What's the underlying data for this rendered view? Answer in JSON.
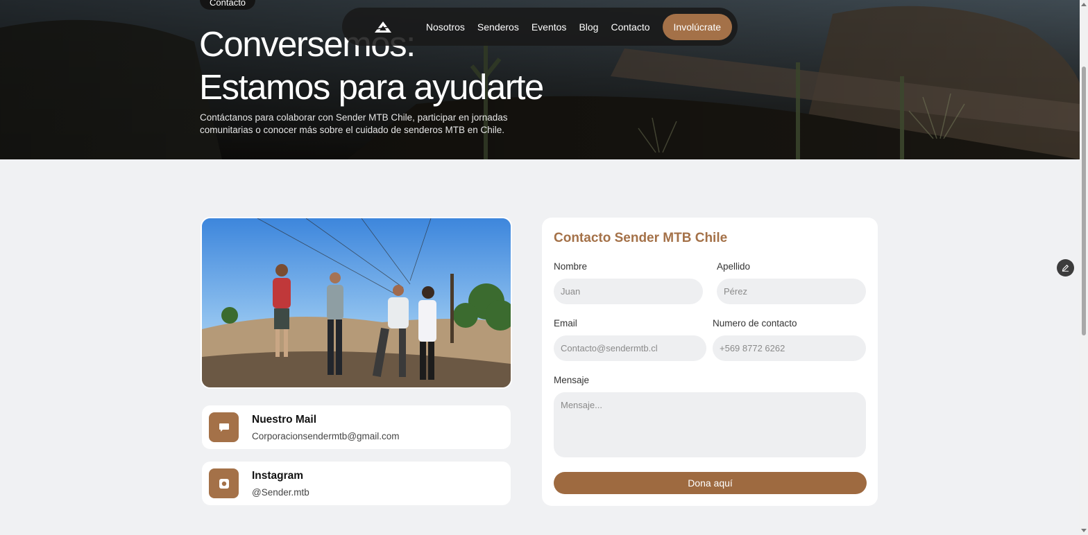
{
  "hero": {
    "badge": "Contacto",
    "title_line1": "Conversemos:",
    "title_line2": "Estamos para ayudarte",
    "description": "Contáctanos para colaborar con Sender MTB Chile, participar en jornadas comunitarias o conocer más sobre el cuidado de senderos MTB en Chile."
  },
  "nav": {
    "logo_icon": "mountain-logo-icon",
    "links": [
      "Nosotros",
      "Senderos",
      "Eventos",
      "Blog",
      "Contacto"
    ],
    "cta": "Involúcrate",
    "cta_color": "#a47148"
  },
  "contact_cards": [
    {
      "icon": "chat-icon",
      "title": "Nuestro Mail",
      "value": "Corporacionsendermtb@gmail.com"
    },
    {
      "icon": "instagram-icon",
      "title": "Instagram",
      "value": "@Sender.mtb"
    }
  ],
  "form": {
    "title": "Contacto Sender MTB Chile",
    "first_name": {
      "label": "Nombre",
      "placeholder": "Juan"
    },
    "last_name": {
      "label": "Apellido",
      "placeholder": "Pérez"
    },
    "email": {
      "label": "Email",
      "placeholder": "Contacto@sendermtb.cl"
    },
    "phone": {
      "label": "Numero de contacto",
      "placeholder": "+569 8772 6262"
    },
    "message": {
      "label": "Mensaje",
      "placeholder": "Mensaje..."
    },
    "submit": "Dona aquí"
  },
  "colors": {
    "accent": "#a47148",
    "background": "#f0f1f3",
    "card": "#ffffff"
  }
}
